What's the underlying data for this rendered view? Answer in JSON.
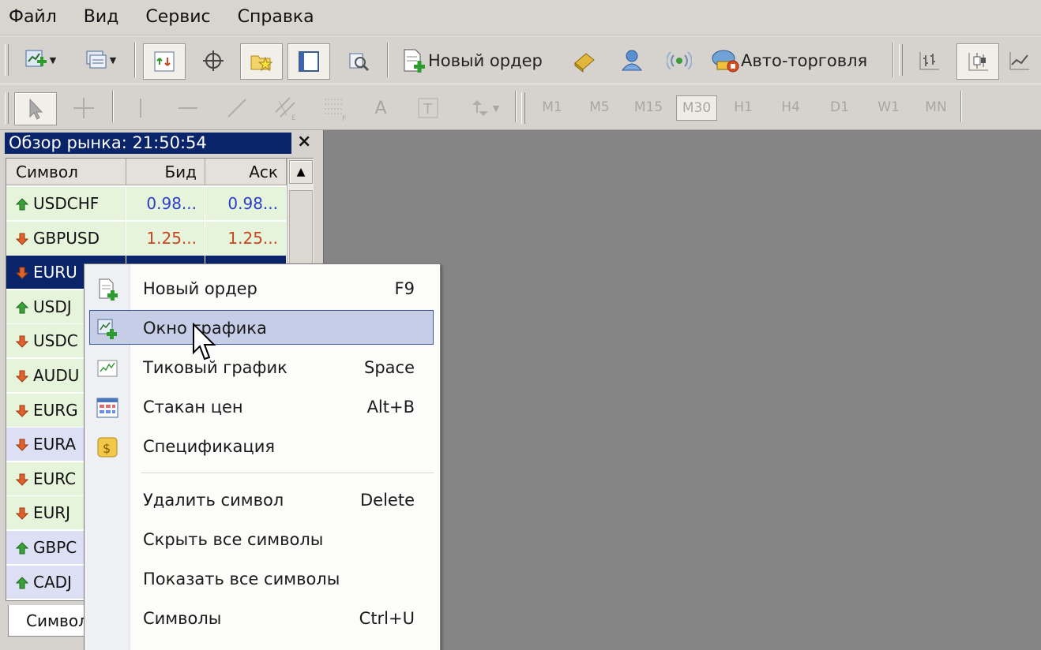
{
  "menu": [
    "Файл",
    "Вид",
    "Сервис",
    "Справка"
  ],
  "toolbar": {
    "new_order_label": "Новый ордер",
    "autotrading_label": "Авто-торговля",
    "timeframes": [
      "M1",
      "M5",
      "M15",
      "M30",
      "H1",
      "H4",
      "D1",
      "W1",
      "MN"
    ],
    "selected_timeframe": "M30"
  },
  "market_watch": {
    "title": "Обзор рынка: 21:50:54",
    "close": "×",
    "columns": [
      "Символ",
      "Бид",
      "Аск"
    ],
    "rows": [
      {
        "symbol": "USDCHF",
        "bid": "0.98...",
        "ask": "0.98...",
        "dir": "up"
      },
      {
        "symbol": "GBPUSD",
        "bid": "1.25...",
        "ask": "1.25...",
        "dir": "down"
      },
      {
        "symbol": "EURU",
        "bid": "",
        "ask": "",
        "dir": "down",
        "selected": true
      },
      {
        "symbol": "USDJ",
        "bid": "",
        "ask": "",
        "dir": "up"
      },
      {
        "symbol": "USDC",
        "bid": "",
        "ask": "",
        "dir": "down"
      },
      {
        "symbol": "AUDU",
        "bid": "",
        "ask": "",
        "dir": "down"
      },
      {
        "symbol": "EURG",
        "bid": "",
        "ask": "",
        "dir": "down"
      },
      {
        "symbol": "EURA",
        "bid": "",
        "ask": "",
        "dir": "down"
      },
      {
        "symbol": "EURC",
        "bid": "",
        "ask": "",
        "dir": "down"
      },
      {
        "symbol": "EURJ",
        "bid": "",
        "ask": "",
        "dir": "down"
      },
      {
        "symbol": "GBPC",
        "bid": "",
        "ask": "",
        "dir": "up"
      },
      {
        "symbol": "CADJ",
        "bid": "",
        "ask": "",
        "dir": "up"
      }
    ],
    "tab_label": "Символ"
  },
  "context_menu": {
    "items": [
      {
        "label": "Новый ордер",
        "shortcut": "F9",
        "icon": "new-order-icon"
      },
      {
        "label": "Окно графика",
        "shortcut": "",
        "icon": "chart-window-icon",
        "highlighted": true
      },
      {
        "label": "Тиковый график",
        "shortcut": "Space",
        "icon": "tick-chart-icon"
      },
      {
        "label": "Стакан цен",
        "shortcut": "Alt+B",
        "icon": "depth-of-market-icon"
      },
      {
        "label": "Спецификация",
        "shortcut": "",
        "icon": "specification-icon"
      },
      {
        "label": "Удалить символ",
        "shortcut": "Delete",
        "icon": ""
      },
      {
        "label": "Скрыть все символы",
        "shortcut": "",
        "icon": ""
      },
      {
        "label": "Показать все символы",
        "shortcut": "",
        "icon": ""
      },
      {
        "label": "Символы",
        "shortcut": "Ctrl+U",
        "icon": ""
      }
    ]
  },
  "colors": {
    "title_bar": "#0a246a",
    "workspace": "#858585",
    "bid_up": "#2a3fc8",
    "bid_down": "#c8461e",
    "row_green": "#e6f4dc",
    "row_blue": "#dde0f4",
    "highlight": "#c5cee6"
  }
}
